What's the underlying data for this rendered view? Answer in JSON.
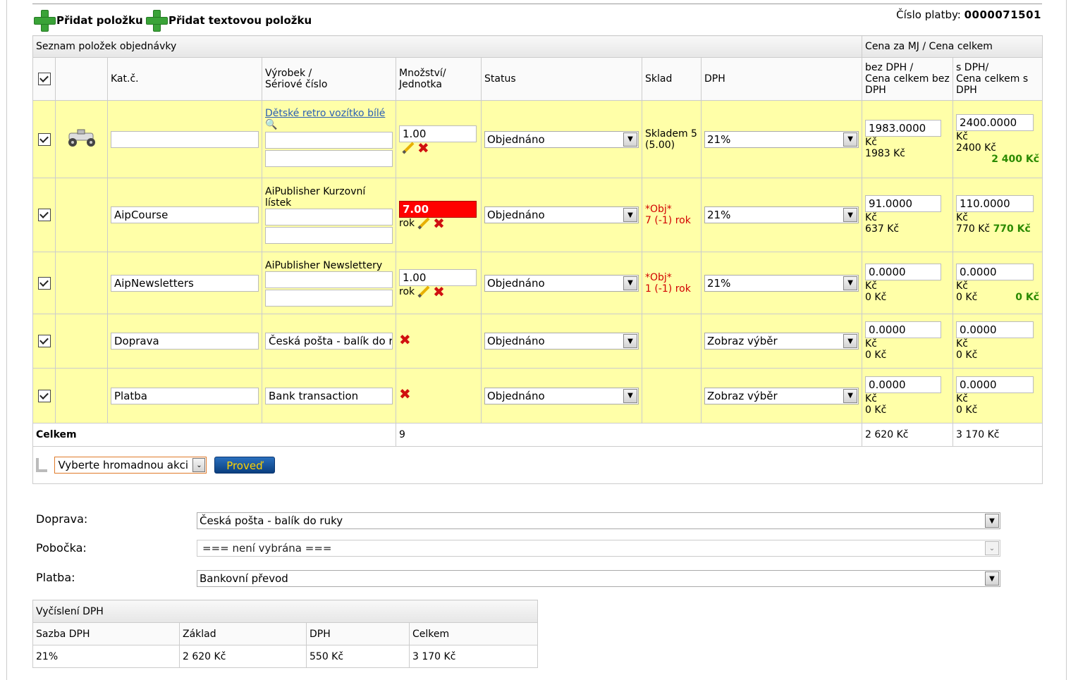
{
  "toolbar": {
    "add_item_label": "Přidat položku",
    "add_text_item_label": "Přidat textovou položku",
    "payment_no_label": "Číslo platby:",
    "payment_no_value": "0000071501"
  },
  "table": {
    "section_title": "Seznam položek objednávky",
    "price_section_title": "Cena za MJ / Cena celkem",
    "headers": {
      "catno": "Kat.č.",
      "product_line1": "Výrobek /",
      "product_line2": "Sériové číslo",
      "qty_line1": "Množství/",
      "qty_line2": "Jednotka",
      "status": "Status",
      "stock": "Sklad",
      "vat": "DPH",
      "net_line1": "bez DPH /",
      "net_line2": "Cena celkem bez",
      "net_line3": "DPH",
      "gross_line1": "s DPH/",
      "gross_line2": "Cena celkem s",
      "gross_line3": "DPH"
    },
    "rows": [
      {
        "catno": "",
        "product_link": "Dětské retro vozítko bílé",
        "qty": "1.00",
        "unit": "",
        "status": "Objednáno",
        "stock_line1": "Skladem 5",
        "stock_line2": "(5.00)",
        "vat": "21%",
        "net_unit": "1983.0000",
        "net_currency": "Kč",
        "net_total": "1983  Kč",
        "gross_unit": "2400.0000",
        "gross_currency": "Kč",
        "gross_total": "2400  Kč",
        "gross_total_bold": "2 400 Kč"
      },
      {
        "catno": "AipCourse",
        "product_text": "AiPublisher Kurzovní lístek",
        "qty": "7.00",
        "unit": "rok",
        "status": "Objednáno",
        "stock_line1": "*Obj*",
        "stock_line2": "7 (-1) rok",
        "vat": "21%",
        "net_unit": "91.0000",
        "net_currency": "Kč",
        "net_total": "637  Kč",
        "gross_unit": "110.0000",
        "gross_currency": "Kč",
        "gross_total": "770  Kč",
        "gross_total_bold": "770 Kč"
      },
      {
        "catno": "AipNewsletters",
        "product_text": "AiPublisher Newslettery",
        "qty": "1.00",
        "unit": "rok",
        "status": "Objednáno",
        "stock_line1": "*Obj*",
        "stock_line2": "1 (-1) rok",
        "vat": "21%",
        "net_unit": "0.0000",
        "net_currency": "Kč",
        "net_total": "0  Kč",
        "gross_unit": "0.0000",
        "gross_currency": "Kč",
        "gross_total": "0  Kč",
        "gross_total_bold": "0 Kč"
      },
      {
        "catno": "Doprava",
        "product_input": "Česká pošta - balík do r",
        "status": "Objednáno",
        "vat": "Zobraz výběr",
        "net_unit": "0.0000",
        "net_currency": "Kč",
        "net_total": "0  Kč",
        "gross_unit": "0.0000",
        "gross_currency": "Kč",
        "gross_total": "0  Kč"
      },
      {
        "catno": "Platba",
        "product_input": "Bank transaction",
        "status": "Objednáno",
        "vat": "Zobraz výběr",
        "net_unit": "0.0000",
        "net_currency": "Kč",
        "net_total": "0  Kč",
        "gross_unit": "0.0000",
        "gross_currency": "Kč",
        "gross_total": "0  Kč"
      }
    ],
    "totals": {
      "label": "Celkem",
      "qty": "9",
      "net": "2 620 Kč",
      "gross": "3 170 Kč"
    },
    "bulk": {
      "select_value": "Vyberte hromadnou akci",
      "button": "Proveď"
    }
  },
  "form": {
    "shipping_label": "Doprava:",
    "shipping_value": "Česká pošta - balík do ruky",
    "branch_label": "Pobočka:",
    "branch_value": "=== není vybrána ===",
    "payment_label": "Platba:",
    "payment_value": "Bankovní převod"
  },
  "vat_summary": {
    "title": "Vyčíslení DPH",
    "headers": [
      "Sazba DPH",
      "Základ",
      "DPH",
      "Celkem"
    ],
    "row": [
      "21%",
      "2 620 Kč",
      "550 Kč",
      "3 170 Kč"
    ]
  }
}
